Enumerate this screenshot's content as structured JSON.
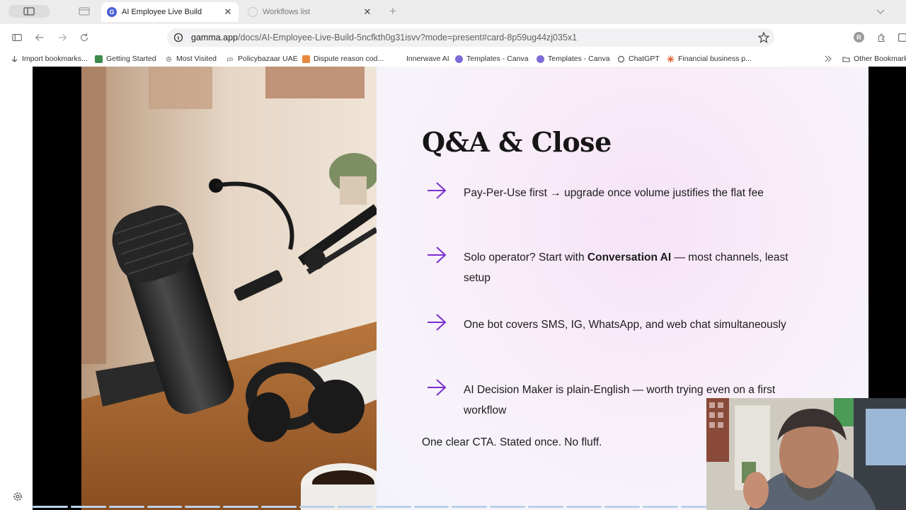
{
  "browser": {
    "tabs": [
      {
        "title": "AI Employee Live Build",
        "active": true
      },
      {
        "title": "Workflows list",
        "active": false
      }
    ],
    "url_host": "gamma.app",
    "url_path": "/docs/AI-Employee-Live-Build-5ncfkth0g31isvv?mode=present#card-8p59ug44zj035x1",
    "profile_initial": "R",
    "bookmarks": [
      "Import bookmarks...",
      "Getting Started",
      "Most Visited",
      "Policybazaar UAE",
      "Dispute reason cod...",
      "Innerwave AI",
      "Templates - Canva",
      "Templates - Canva",
      "ChatGPT",
      "Financial business p...",
      "Other Bookmarks"
    ]
  },
  "slide": {
    "title": "Q&A & Close",
    "bullets": [
      {
        "parts": [
          {
            "text": "Pay-Per-Use first → upgrade once volume justifies the flat fee",
            "bold": false
          }
        ]
      },
      {
        "parts": [
          {
            "text": "Solo operator? Start with ",
            "bold": false
          },
          {
            "text": "Conversation AI",
            "bold": true
          },
          {
            "text": " — most channels, least setup",
            "bold": false
          }
        ]
      },
      {
        "parts": [
          {
            "text": "One bot covers SMS, IG, WhatsApp, and web chat simultaneously",
            "bold": false
          }
        ]
      },
      {
        "parts": [
          {
            "text": "AI Decision Maker is plain-English — worth trying even on a first workflow",
            "bold": false
          }
        ]
      }
    ],
    "closing": "One clear CTA. Stated once. No fluff.",
    "accent_color": "#7b2fd0"
  }
}
